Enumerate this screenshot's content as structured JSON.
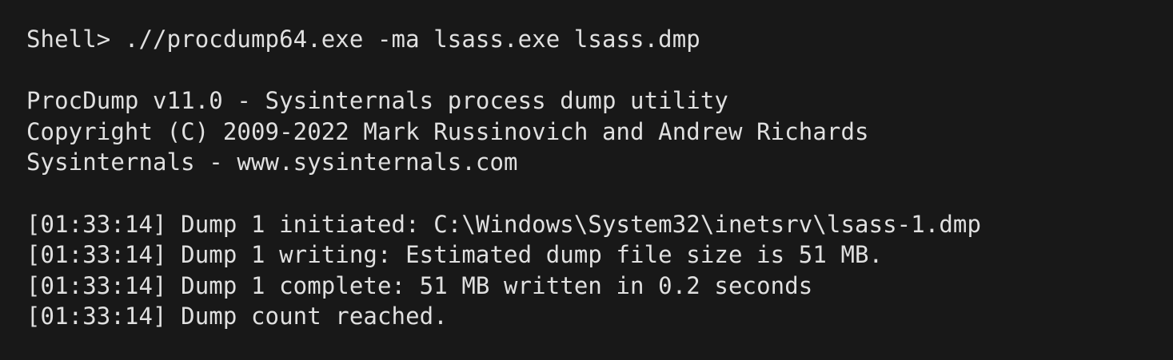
{
  "terminal": {
    "command_line": "Shell> .//procdump64.exe -ma lsass.exe lsass.dmp",
    "banner": [
      "ProcDump v11.0 - Sysinternals process dump utility",
      "Copyright (C) 2009-2022 Mark Russinovich and Andrew Richards",
      "Sysinternals - www.sysinternals.com"
    ],
    "log": [
      "[01:33:14] Dump 1 initiated: C:\\Windows\\System32\\inetsrv\\lsass-1.dmp",
      "[01:33:14] Dump 1 writing: Estimated dump file size is 51 MB.",
      "[01:33:14] Dump 1 complete: 51 MB written in 0.2 seconds",
      "[01:33:14] Dump count reached."
    ],
    "colors": {
      "background": "#181818",
      "foreground": "#e0e0e0"
    }
  }
}
